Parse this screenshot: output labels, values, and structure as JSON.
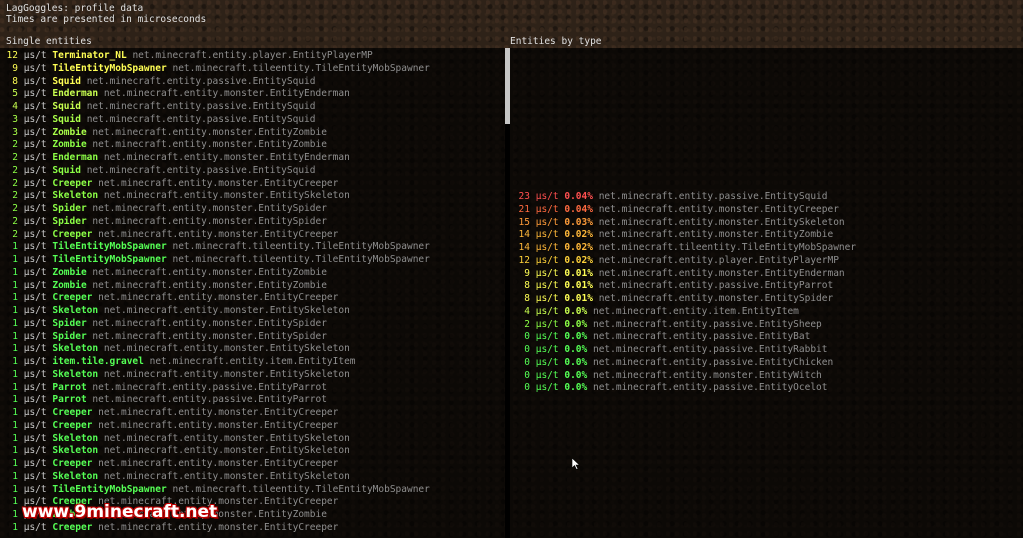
{
  "header": {
    "title": "LagGoggles: profile data",
    "subtitle": "Times are presented in microseconds"
  },
  "left": {
    "title": "Single entities",
    "rows": [
      {
        "value": "12",
        "unit": "µs/t",
        "name": "Terminator_NL",
        "cls": "net.minecraft.entity.player.EntityPlayerMP",
        "color": "#ffff55"
      },
      {
        "value": "9",
        "unit": "µs/t",
        "name": "TileEntityMobSpawner",
        "cls": "net.minecraft.tileentity.TileEntityMobSpawner",
        "color": "#ffff55"
      },
      {
        "value": "8",
        "unit": "µs/t",
        "name": "Squid",
        "cls": "net.minecraft.entity.passive.EntitySquid",
        "color": "#ffff55"
      },
      {
        "value": "5",
        "unit": "µs/t",
        "name": "Enderman",
        "cls": "net.minecraft.entity.monster.EntityEnderman",
        "color": "#c8ff50"
      },
      {
        "value": "4",
        "unit": "µs/t",
        "name": "Squid",
        "cls": "net.minecraft.entity.passive.EntitySquid",
        "color": "#c8ff50"
      },
      {
        "value": "3",
        "unit": "µs/t",
        "name": "Squid",
        "cls": "net.minecraft.entity.passive.EntitySquid",
        "color": "#aaff4a"
      },
      {
        "value": "3",
        "unit": "µs/t",
        "name": "Zombie",
        "cls": "net.minecraft.entity.monster.EntityZombie",
        "color": "#aaff4a"
      },
      {
        "value": "2",
        "unit": "µs/t",
        "name": "Zombie",
        "cls": "net.minecraft.entity.monster.EntityZombie",
        "color": "#8cff46"
      },
      {
        "value": "2",
        "unit": "µs/t",
        "name": "Enderman",
        "cls": "net.minecraft.entity.monster.EntityEnderman",
        "color": "#8cff46"
      },
      {
        "value": "2",
        "unit": "µs/t",
        "name": "Squid",
        "cls": "net.minecraft.entity.passive.EntitySquid",
        "color": "#8cff46"
      },
      {
        "value": "2",
        "unit": "µs/t",
        "name": "Creeper",
        "cls": "net.minecraft.entity.monster.EntityCreeper",
        "color": "#8cff46"
      },
      {
        "value": "2",
        "unit": "µs/t",
        "name": "Skeleton",
        "cls": "net.minecraft.entity.monster.EntitySkeleton",
        "color": "#8cff46"
      },
      {
        "value": "2",
        "unit": "µs/t",
        "name": "Spider",
        "cls": "net.minecraft.entity.monster.EntitySpider",
        "color": "#8cff46"
      },
      {
        "value": "2",
        "unit": "µs/t",
        "name": "Spider",
        "cls": "net.minecraft.entity.monster.EntitySpider",
        "color": "#8cff46"
      },
      {
        "value": "2",
        "unit": "µs/t",
        "name": "Creeper",
        "cls": "net.minecraft.entity.monster.EntityCreeper",
        "color": "#8cff46"
      },
      {
        "value": "1",
        "unit": "µs/t",
        "name": "TileEntityMobSpawner",
        "cls": "net.minecraft.tileentity.TileEntityMobSpawner",
        "color": "#55ff55"
      },
      {
        "value": "1",
        "unit": "µs/t",
        "name": "TileEntityMobSpawner",
        "cls": "net.minecraft.tileentity.TileEntityMobSpawner",
        "color": "#55ff55"
      },
      {
        "value": "1",
        "unit": "µs/t",
        "name": "Zombie",
        "cls": "net.minecraft.entity.monster.EntityZombie",
        "color": "#55ff55"
      },
      {
        "value": "1",
        "unit": "µs/t",
        "name": "Zombie",
        "cls": "net.minecraft.entity.monster.EntityZombie",
        "color": "#55ff55"
      },
      {
        "value": "1",
        "unit": "µs/t",
        "name": "Creeper",
        "cls": "net.minecraft.entity.monster.EntityCreeper",
        "color": "#55ff55"
      },
      {
        "value": "1",
        "unit": "µs/t",
        "name": "Skeleton",
        "cls": "net.minecraft.entity.monster.EntitySkeleton",
        "color": "#55ff55"
      },
      {
        "value": "1",
        "unit": "µs/t",
        "name": "Spider",
        "cls": "net.minecraft.entity.monster.EntitySpider",
        "color": "#55ff55"
      },
      {
        "value": "1",
        "unit": "µs/t",
        "name": "Spider",
        "cls": "net.minecraft.entity.monster.EntitySpider",
        "color": "#55ff55"
      },
      {
        "value": "1",
        "unit": "µs/t",
        "name": "Skeleton",
        "cls": "net.minecraft.entity.monster.EntitySkeleton",
        "color": "#55ff55"
      },
      {
        "value": "1",
        "unit": "µs/t",
        "name": "item.tile.gravel",
        "cls": "net.minecraft.entity.item.EntityItem",
        "color": "#55ff55"
      },
      {
        "value": "1",
        "unit": "µs/t",
        "name": "Skeleton",
        "cls": "net.minecraft.entity.monster.EntitySkeleton",
        "color": "#55ff55"
      },
      {
        "value": "1",
        "unit": "µs/t",
        "name": "Parrot",
        "cls": "net.minecraft.entity.passive.EntityParrot",
        "color": "#55ff55"
      },
      {
        "value": "1",
        "unit": "µs/t",
        "name": "Parrot",
        "cls": "net.minecraft.entity.passive.EntityParrot",
        "color": "#55ff55"
      },
      {
        "value": "1",
        "unit": "µs/t",
        "name": "Creeper",
        "cls": "net.minecraft.entity.monster.EntityCreeper",
        "color": "#55ff55"
      },
      {
        "value": "1",
        "unit": "µs/t",
        "name": "Creeper",
        "cls": "net.minecraft.entity.monster.EntityCreeper",
        "color": "#55ff55"
      },
      {
        "value": "1",
        "unit": "µs/t",
        "name": "Skeleton",
        "cls": "net.minecraft.entity.monster.EntitySkeleton",
        "color": "#55ff55"
      },
      {
        "value": "1",
        "unit": "µs/t",
        "name": "Skeleton",
        "cls": "net.minecraft.entity.monster.EntitySkeleton",
        "color": "#55ff55"
      },
      {
        "value": "1",
        "unit": "µs/t",
        "name": "Creeper",
        "cls": "net.minecraft.entity.monster.EntityCreeper",
        "color": "#55ff55"
      },
      {
        "value": "1",
        "unit": "µs/t",
        "name": "Skeleton",
        "cls": "net.minecraft.entity.monster.EntitySkeleton",
        "color": "#55ff55"
      },
      {
        "value": "1",
        "unit": "µs/t",
        "name": "TileEntityMobSpawner",
        "cls": "net.minecraft.tileentity.TileEntityMobSpawner",
        "color": "#55ff55"
      },
      {
        "value": "1",
        "unit": "µs/t",
        "name": "Creeper",
        "cls": "net.minecraft.entity.monster.EntityCreeper",
        "color": "#55ff55"
      },
      {
        "value": "1",
        "unit": "µs/t",
        "name": "Zombie",
        "cls": "net.minecraft.entity.monster.EntityZombie",
        "color": "#55ff55"
      },
      {
        "value": "1",
        "unit": "µs/t",
        "name": "Creeper",
        "cls": "net.minecraft.entity.monster.EntityCreeper",
        "color": "#55ff55"
      }
    ]
  },
  "right": {
    "title": "Entities by type",
    "rows": [
      {
        "value": "23",
        "unit": "µs/t",
        "pct": "0.04%",
        "cls": "net.minecraft.entity.passive.EntitySquid",
        "color": "#ff5050"
      },
      {
        "value": "21",
        "unit": "µs/t",
        "pct": "0.04%",
        "cls": "net.minecraft.entity.monster.EntityCreeper",
        "color": "#ff6a40"
      },
      {
        "value": "15",
        "unit": "µs/t",
        "pct": "0.03%",
        "cls": "net.minecraft.entity.monster.EntitySkeleton",
        "color": "#ff9c3a"
      },
      {
        "value": "14",
        "unit": "µs/t",
        "pct": "0.02%",
        "cls": "net.minecraft.entity.monster.EntityZombie",
        "color": "#ffb83a"
      },
      {
        "value": "14",
        "unit": "µs/t",
        "pct": "0.02%",
        "cls": "net.minecraft.tileentity.TileEntityMobSpawner",
        "color": "#ffb83a"
      },
      {
        "value": "12",
        "unit": "µs/t",
        "pct": "0.02%",
        "cls": "net.minecraft.entity.player.EntityPlayerMP",
        "color": "#ffd23a"
      },
      {
        "value": "9",
        "unit": "µs/t",
        "pct": "0.01%",
        "cls": "net.minecraft.entity.monster.EntityEnderman",
        "color": "#ffff55"
      },
      {
        "value": "8",
        "unit": "µs/t",
        "pct": "0.01%",
        "cls": "net.minecraft.entity.passive.EntityParrot",
        "color": "#ffff55"
      },
      {
        "value": "8",
        "unit": "µs/t",
        "pct": "0.01%",
        "cls": "net.minecraft.entity.monster.EntitySpider",
        "color": "#ffff55"
      },
      {
        "value": "4",
        "unit": "µs/t",
        "pct": "0.0%",
        "cls": "net.minecraft.entity.item.EntityItem",
        "color": "#c8ff50"
      },
      {
        "value": "2",
        "unit": "µs/t",
        "pct": "0.0%",
        "cls": "net.minecraft.entity.passive.EntitySheep",
        "color": "#8cff46"
      },
      {
        "value": "0",
        "unit": "µs/t",
        "pct": "0.0%",
        "cls": "net.minecraft.entity.passive.EntityBat",
        "color": "#55ff55"
      },
      {
        "value": "0",
        "unit": "µs/t",
        "pct": "0.0%",
        "cls": "net.minecraft.entity.passive.EntityRabbit",
        "color": "#55ff55"
      },
      {
        "value": "0",
        "unit": "µs/t",
        "pct": "0.0%",
        "cls": "net.minecraft.entity.passive.EntityChicken",
        "color": "#55ff55"
      },
      {
        "value": "0",
        "unit": "µs/t",
        "pct": "0.0%",
        "cls": "net.minecraft.entity.monster.EntityWitch",
        "color": "#55ff55"
      },
      {
        "value": "0",
        "unit": "µs/t",
        "pct": "0.0%",
        "cls": "net.minecraft.entity.passive.EntityOcelot",
        "color": "#55ff55"
      }
    ]
  },
  "watermark": "www.9minecraft.net",
  "scroll_fraction": 0.0,
  "cursor_icon": "mouse-pointer-icon"
}
